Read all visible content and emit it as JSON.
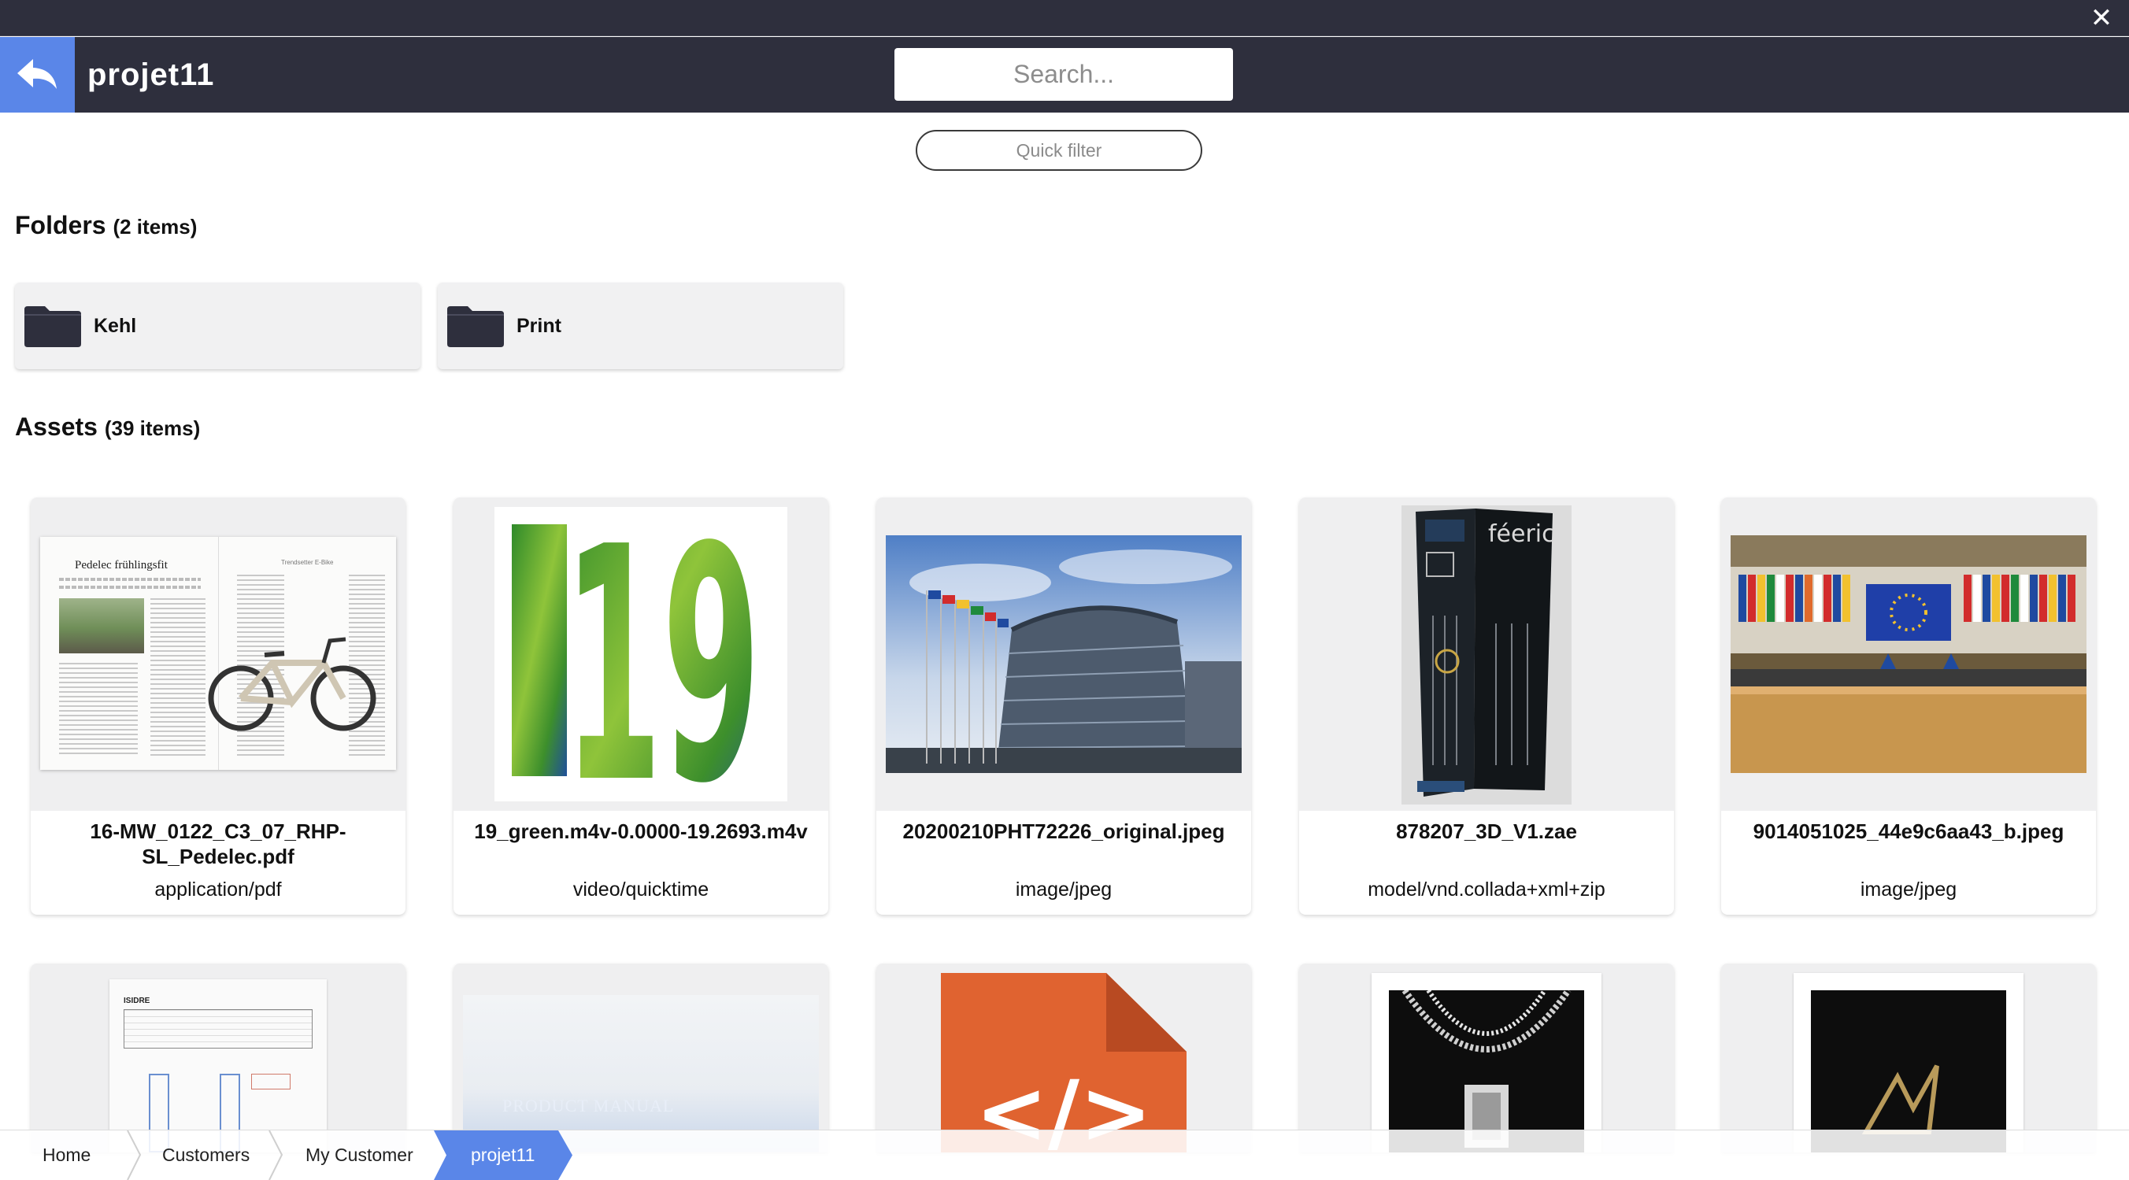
{
  "window": {
    "close_label": "✕"
  },
  "header": {
    "title": "projet11",
    "search_placeholder": "Search..."
  },
  "filter": {
    "quick_filter_label": "Quick filter"
  },
  "folders": {
    "title": "Folders",
    "count": "(2 items)",
    "items": [
      {
        "label": "Kehl"
      },
      {
        "label": "Print"
      }
    ]
  },
  "assets": {
    "title": "Assets",
    "count": "(39 items)",
    "items": [
      {
        "name": "16-MW_0122_C3_07_RHP-SL_Pedelec.pdf",
        "mime": "application/pdf",
        "thumb_heading": "Pedelec frühlingsfit",
        "thumb_subheading": "Trendsetter E-Bike"
      },
      {
        "name": "19_green.m4v-0.0000-19.2693.m4v",
        "mime": "video/quicktime",
        "thumb_text": "19"
      },
      {
        "name": "20200210PHT72226_original.jpeg",
        "mime": "image/jpeg"
      },
      {
        "name": "878207_3D_V1.zae",
        "mime": "model/vnd.collada+xml+zip",
        "thumb_brand": "féeric"
      },
      {
        "name": "9014051025_44e9c6aa43_b.jpeg",
        "mime": "image/jpeg"
      }
    ],
    "row2": [
      {
        "thumb_text": "ISIDRE"
      },
      {
        "thumb_text": "PRODUCT MANUAL"
      },
      {
        "thumb_text": "</>"
      },
      {
        "thumb_text": ""
      },
      {
        "thumb_text": ""
      }
    ]
  },
  "breadcrumb": {
    "items": [
      {
        "label": "Home"
      },
      {
        "label": "Customers"
      },
      {
        "label": "My Customer"
      },
      {
        "label": "projet11"
      }
    ]
  },
  "colors": {
    "header_bg": "#2e2f3d",
    "accent": "#5a86e8",
    "card_bg": "#efeff0"
  }
}
